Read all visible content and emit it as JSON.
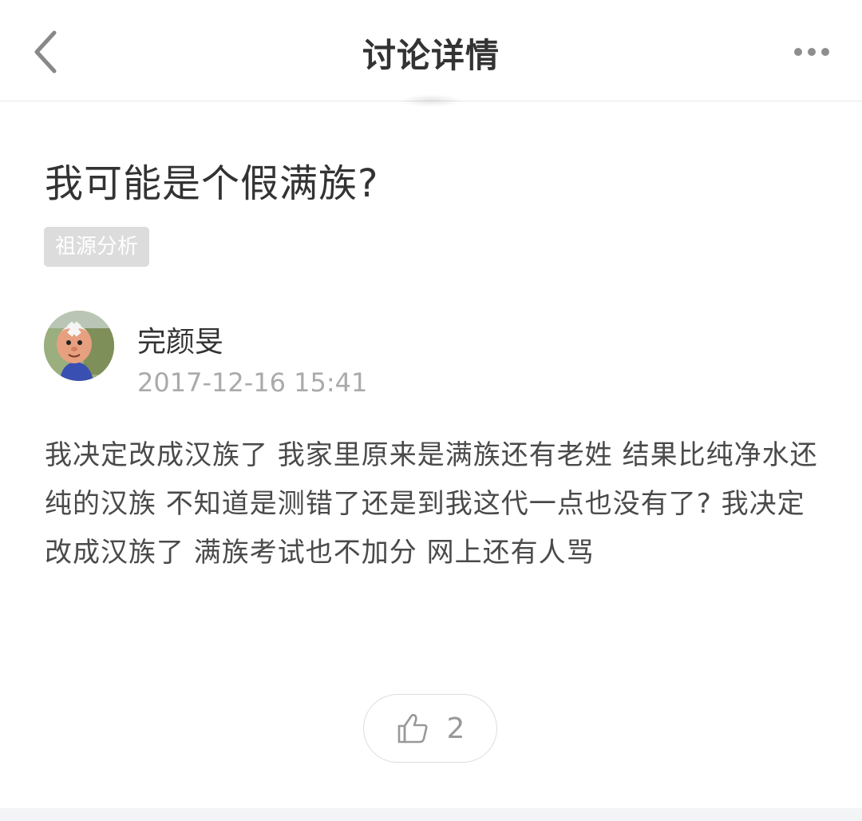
{
  "navbar": {
    "title": "讨论详情",
    "back_icon": "chevron-left-icon",
    "more_icon": "more-horizontal-icon"
  },
  "post": {
    "title": "我可能是个假满族?",
    "tag": "祖源分析",
    "author": {
      "name": "完颜旻",
      "avatar": "cartoon-avatar"
    },
    "time": "2017-12-16 15:41",
    "body": "我决定改成汉族了 我家里原来是满族还有老姓 结果比纯净水还纯的汉族 不知道是测错了还是到我这代一点也没有了? 我决定改成汉族了 满族考试也不加分 网上还有人骂",
    "likes": {
      "icon": "thumbs-up-icon",
      "count": "2"
    }
  },
  "colors": {
    "text_primary": "#333333",
    "text_body": "#4a4a4a",
    "text_muted": "#aaaaaa",
    "tag_bg": "#dcdcdc",
    "divider": "#e6e6e6"
  }
}
